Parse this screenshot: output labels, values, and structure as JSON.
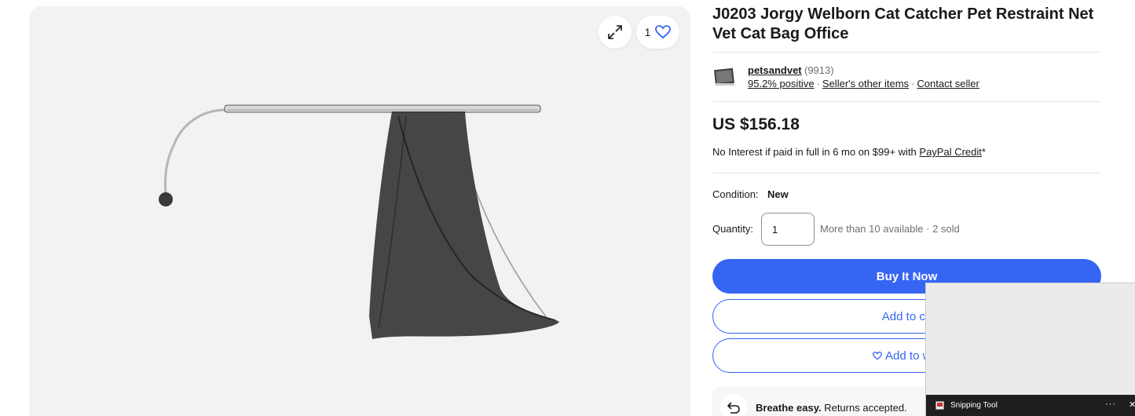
{
  "gallery": {
    "watch_count": "1",
    "icons": {
      "expand": "expand-icon",
      "heart": "heart-icon"
    }
  },
  "listing": {
    "title": "J0203 Jorgy Welborn Cat Catcher Pet Restraint Net Vet Cat Bag Office",
    "seller": {
      "name": "petsandvet",
      "feedback_count": "(9913)",
      "positive": "95.2% positive",
      "other_items": "Seller's other items",
      "contact": "Contact seller",
      "separator": "·"
    },
    "price": "US $156.18",
    "credit": {
      "text": "No Interest if paid in full in 6 mo on $99+ with ",
      "link": "PayPal Credit",
      "suffix": "*"
    },
    "condition": {
      "label": "Condition:",
      "value": "New"
    },
    "quantity": {
      "label": "Quantity:",
      "value": "1",
      "availability": "More than 10 available · 2 sold"
    },
    "buttons": {
      "buy": "Buy It Now",
      "cart": "Add to ca",
      "watch": "Add to wat"
    },
    "returns": {
      "bold": "Breathe easy.",
      "text": " Returns accepted."
    }
  },
  "snipping_tool": {
    "title": "Snipping Tool",
    "more": "···",
    "close": "✕"
  },
  "colors": {
    "accent": "#3665f3",
    "text": "#191919",
    "muted": "#707070",
    "gallery_bg": "#f2f2f2"
  }
}
